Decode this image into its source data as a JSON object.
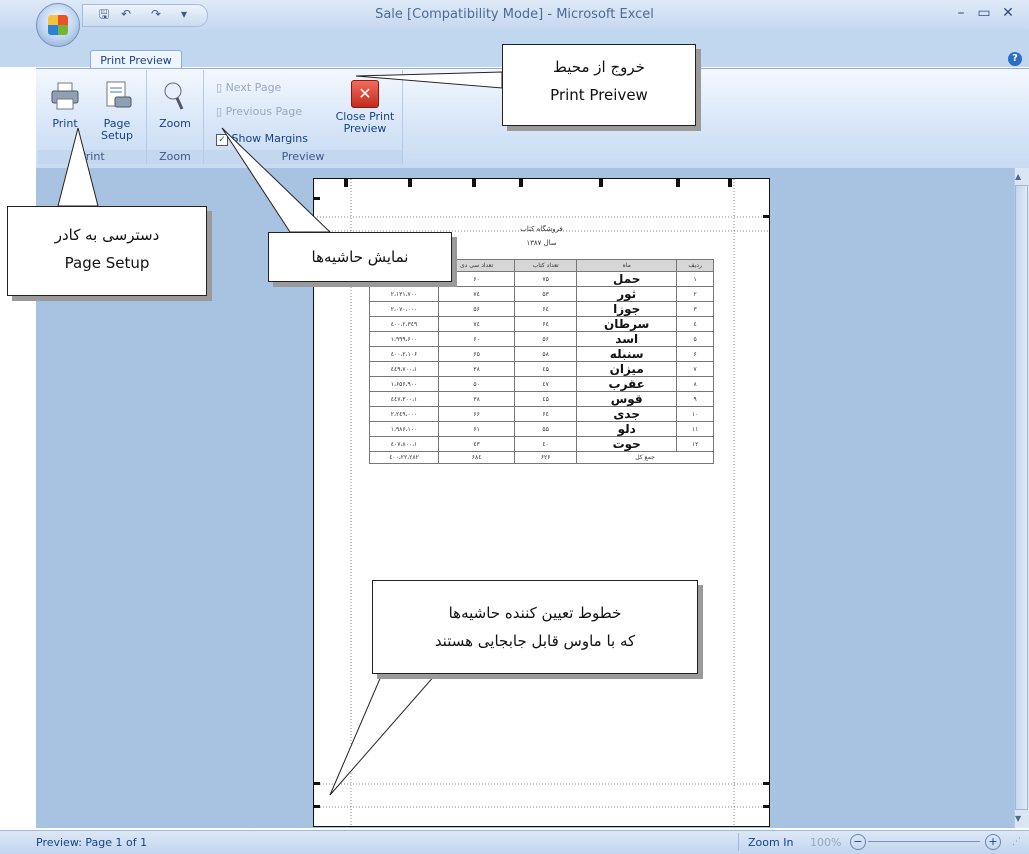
{
  "window": {
    "title": "Sale  [Compatibility Mode] - Microsoft Excel",
    "controls": [
      "–",
      "▭",
      "✕"
    ],
    "help": "?"
  },
  "tabs": [
    {
      "label": "Print Preview"
    }
  ],
  "ribbon": {
    "print_group": {
      "label": "Print",
      "print": "Print",
      "page_setup_l1": "Page",
      "page_setup_l2": "Setup"
    },
    "zoom_group": {
      "label": "Zoom",
      "zoom": "Zoom"
    },
    "preview_group": {
      "label": "Preview",
      "next_page": "Next Page",
      "previous_page": "Previous Page",
      "show_margins": "Show Margins",
      "close_l1": "Close Print",
      "close_l2": "Preview"
    }
  },
  "callouts": {
    "exit": {
      "line1": "خروج از محیط",
      "line2": "Print Preivew"
    },
    "page_setup": {
      "line1": "دسترسی به کادر",
      "line2": "Page Setup"
    },
    "margins": {
      "line1": "نمایش حاشیه‌ها"
    },
    "margin_lines": {
      "line1": "خطوط تعیین کننده حاشیه‌ها",
      "line2": "که با ماوس قابل جابجایی هستند"
    }
  },
  "sheet": {
    "title": "فروشگاه کتاب",
    "subtitle": "سال ۱۳۸۷",
    "headers": [
      "ردیف",
      "ماه",
      "تعداد کتاب",
      "تعداد سی دی",
      "مبلغ"
    ],
    "rows": [
      [
        "۱",
        "حمل",
        "۷۵",
        "۶۰",
        ""
      ],
      [
        "۲",
        "ثور",
        "۵۳",
        "۷٤",
        "۲،۱۳۱،۷۰۰"
      ],
      [
        "۳",
        "جوزا",
        "۶٤",
        "۵۶",
        "۲،۰۷۰،۰۰۰"
      ],
      [
        "٤",
        "سرطان",
        "۶٤",
        "۷٤",
        "۲،۳٤۹،٤۰۰"
      ],
      [
        "۵",
        "اسد",
        "۵۶",
        "۶۰",
        "۱،۹۹۹،۶۰۰"
      ],
      [
        "۶",
        "سنبله",
        "۵۸",
        "۶۵",
        "۲،۱۰۶،٤۰۰"
      ],
      [
        "۷",
        "میزان",
        "٤۵",
        "۳۸",
        "۱،٤٤۹،۷۰۰"
      ],
      [
        "۸",
        "عقرب",
        "٤۷",
        "۵۰",
        "۱،۶۵۶،۹۰۰"
      ],
      [
        "۹",
        "قوس",
        "٤۵",
        "۳۸",
        "۱،٤٤۷،۳۰۰"
      ],
      [
        "۱۰",
        "جدی",
        "۶٤",
        "۶۶",
        "۲،۲٤۹،۰۰۰"
      ],
      [
        "۱۱",
        "دلو",
        "۵۵",
        "۶۱",
        "۱،۹۸۶،۱۰۰"
      ],
      [
        "۱۲",
        "حوت",
        "٤۰",
        "٤۳",
        "۱،٤۰۷،۸۰۰"
      ]
    ],
    "total_label": "جمع کل",
    "totals": [
      "۶۲۶",
      "۶۸٤",
      "۲۲،۲۸۲،٤۰۰"
    ]
  },
  "status": {
    "page_info": "Preview: Page 1 of 1",
    "zoom_in": "Zoom In",
    "zoom_level": "100%",
    "minus": "−",
    "plus": "+"
  }
}
